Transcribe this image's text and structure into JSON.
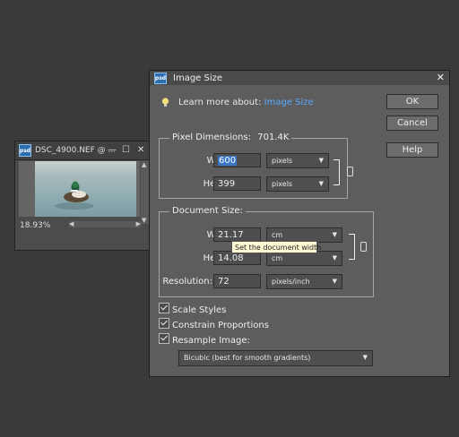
{
  "document_window": {
    "title": "DSC_4900.NEF @ ...",
    "zoom": "18.93%",
    "badge": "psd"
  },
  "dialog": {
    "badge": "psd",
    "title": "Image Size",
    "learn_prefix": "Learn more about: ",
    "learn_link": "Image Size",
    "buttons": {
      "ok": "OK",
      "cancel": "Cancel",
      "help": "Help"
    },
    "pixel_dimensions": {
      "title": "Pixel Dimensions:",
      "value": "701.4K",
      "width_label": "Width:",
      "width_value": "600",
      "width_unit": "pixels",
      "height_label": "Height:",
      "height_value": "399",
      "height_unit": "pixels"
    },
    "document_size": {
      "title": "Document Size:",
      "width_label": "Width:",
      "width_value": "21.17",
      "width_unit": "cm",
      "height_label": "Height:",
      "height_value": "14.08",
      "height_unit": "cm",
      "resolution_label": "Resolution:",
      "resolution_value": "72",
      "resolution_unit": "pixels/inch"
    },
    "tooltip": "Set the document width",
    "options": {
      "scale_styles": "Scale Styles",
      "constrain_proportions": "Constrain Proportions",
      "resample_image": "Resample Image:",
      "resample_method": "Bicubic (best for smooth gradients)"
    }
  }
}
